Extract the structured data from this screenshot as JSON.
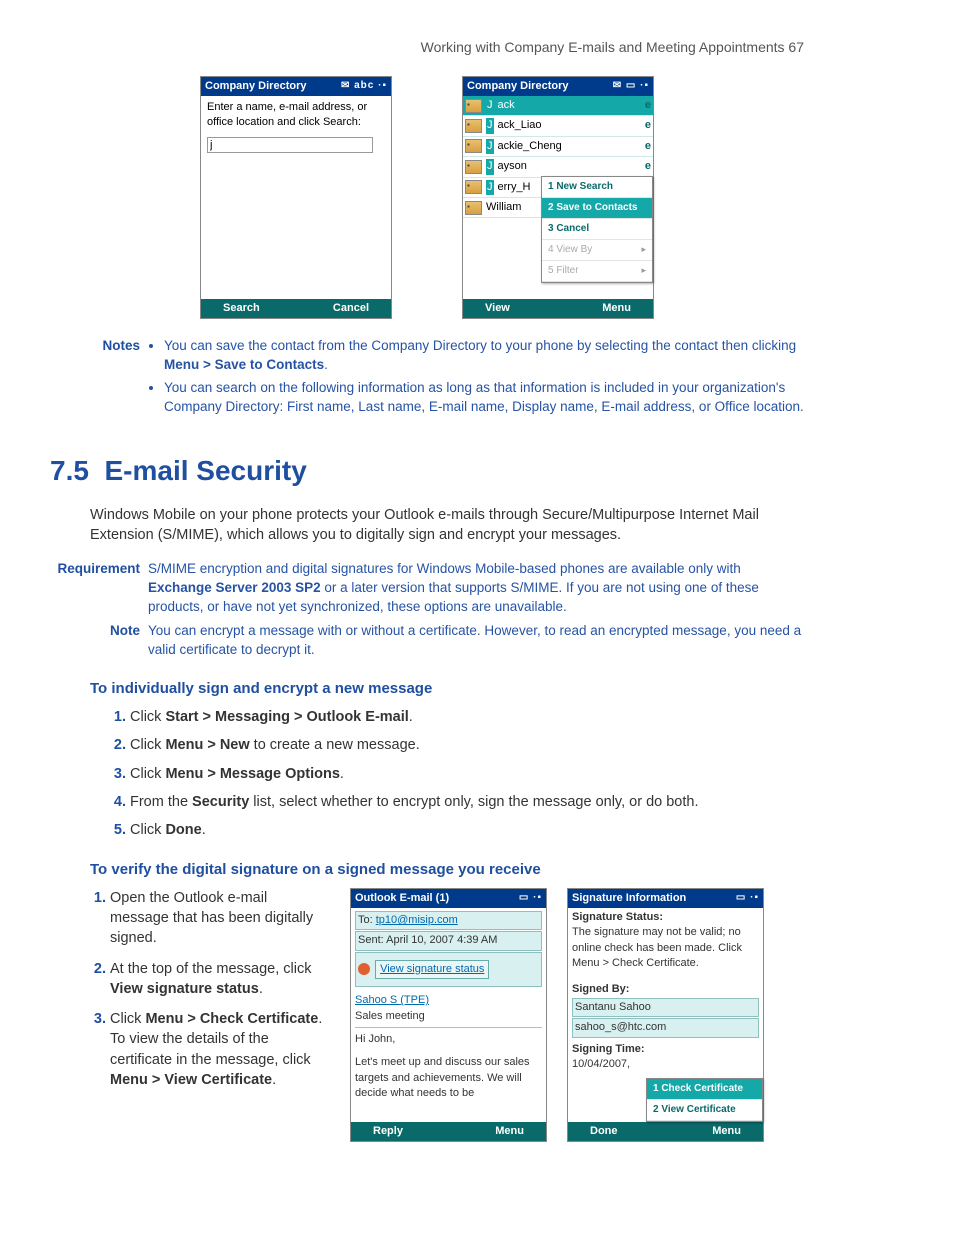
{
  "header": {
    "title": "Working with Company E-mails and Meeting Appointments  67"
  },
  "screenshot1": {
    "title": "Company Directory",
    "icons": "✉ abc ·▪",
    "prompt": "Enter a name, e-mail address, or office location and click Search:",
    "input_value": "j",
    "left_softkey": "Search",
    "right_softkey": "Cancel"
  },
  "screenshot2": {
    "title": "Company Directory",
    "icons": "✉ ▭ ·▪",
    "rows": [
      {
        "pre": "J",
        "rest": "ack",
        "e": "e",
        "selected": true
      },
      {
        "pre": "J",
        "rest": "ack_Liao",
        "e": "e"
      },
      {
        "pre": "J",
        "rest": "ackie_Cheng",
        "e": "e"
      },
      {
        "pre": "J",
        "rest": "ayson",
        "e": "e"
      },
      {
        "pre": "J",
        "rest": "erry_H",
        "e": ""
      },
      {
        "pre": "",
        "rest": "William",
        "e": ""
      }
    ],
    "menu": [
      {
        "text": "1 New Search"
      },
      {
        "text": "2 Save to Contacts",
        "selected": true
      },
      {
        "text": "3 Cancel"
      },
      {
        "text": "4 View By",
        "disabled": true,
        "arrow": true
      },
      {
        "text": "5 Filter",
        "disabled": true,
        "arrow": true
      }
    ],
    "left_softkey": "View",
    "right_softkey": "Menu"
  },
  "notes_block": {
    "label": "Notes",
    "items": [
      {
        "pre": "You can save the contact from the Company Directory to your phone by selecting the contact then clicking ",
        "b1": "Menu > Save to Contacts",
        "post": "."
      },
      {
        "pre": "You can search on the following information as long as that information is included in your organization's Company Directory: First name, Last name, E-mail name, Display name, E-mail address, or Office location.",
        "b1": "",
        "post": ""
      }
    ]
  },
  "section": {
    "num": "7.5",
    "title": "E-mail Security"
  },
  "intro": "Windows Mobile on your phone protects your Outlook e-mails through Secure/Multipurpose Internet Mail Extension (S/MIME), which allows you to digitally sign and encrypt your messages.",
  "requirement": {
    "label": "Requirement",
    "pre": "S/MIME encryption and digital signatures for Windows Mobile-based phones are available only with ",
    "b": "Exchange Server 2003 SP2",
    "post": " or a later version that supports S/MIME. If you are not using one of these products, or have not yet synchronized, these options are unavailable."
  },
  "note2": {
    "label": "Note",
    "text": "You can encrypt a message with or without a certificate. However, to read an encrypted message, you need a valid certificate to decrypt it."
  },
  "sub1": "To individually sign and encrypt a new message",
  "steps1": [
    {
      "pre": "Click ",
      "b": "Start > Messaging > Outlook E-mail",
      "post": "."
    },
    {
      "pre": "Click ",
      "b": "Menu > New",
      "post": " to create a new message."
    },
    {
      "pre": "Click ",
      "b": "Menu > Message Options",
      "post": "."
    },
    {
      "pre": "From the ",
      "b": "Security",
      "post": " list, select whether to encrypt only, sign the message only, or do both."
    },
    {
      "pre": "Click ",
      "b": "Done",
      "post": "."
    }
  ],
  "sub2": "To verify the digital signature on a signed message you receive",
  "steps2": [
    {
      "pre": "Open the Outlook e-mail message that has been digitally signed.",
      "b": "",
      "post": ""
    },
    {
      "pre": "At the top of the message, click ",
      "b": "View signature status",
      "post": "."
    },
    {
      "pre": "Click ",
      "b": "Menu > Check Certificate",
      "post": ". To view the details of the certificate in the message, click ",
      "b2": "Menu > View Certificate",
      "post2": "."
    }
  ],
  "screenshot3": {
    "title": "Outlook E-mail (1)",
    "icons": "▭ ·▪",
    "to_label": "To:  ",
    "to_value": "tp10@misip.com",
    "sent": "Sent: April 10, 2007 4:39 AM",
    "sig_button": "View signature status",
    "from": "Sahoo S (TPE)",
    "subject": "Sales meeting",
    "greeting": "Hi John,",
    "body": "Let's meet up and discuss our sales targets and achievements. We will decide what needs to be",
    "left_softkey": "Reply",
    "right_softkey": "Menu"
  },
  "screenshot4": {
    "title": "Signature Information",
    "icons": "▭ ·▪",
    "status_label": "Signature Status:",
    "status_text": "The signature may not be valid; no online check has been made. Click Menu > Check Certificate.",
    "signed_label": "Signed By:",
    "signed_name": "Santanu Sahoo",
    "signed_email": "sahoo_s@htc.com",
    "time_label": "Signing Time:",
    "time_value": "10/04/2007,",
    "menu": [
      {
        "text": "1 Check Certificate",
        "selected": true
      },
      {
        "text": "2 View Certificate"
      }
    ],
    "left_softkey": "Done",
    "right_softkey": "Menu"
  }
}
